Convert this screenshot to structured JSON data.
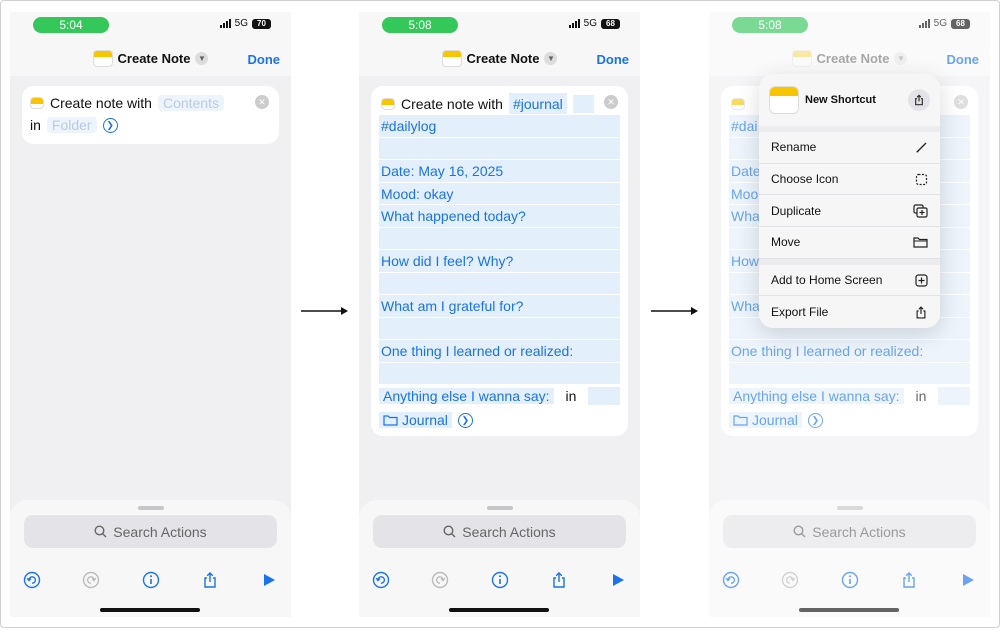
{
  "status": {
    "time_1": "5:04",
    "time_2": "5:08",
    "time_3": "5:08",
    "network": "5G",
    "battery_1": "70",
    "battery_2": "68",
    "battery_3": "68"
  },
  "nav": {
    "title": "Create Note",
    "done_label": "Done"
  },
  "action_empty": {
    "verb": "Create note with",
    "contents_placeholder": "Contents",
    "in_label": "in",
    "folder_placeholder": "Folder"
  },
  "action_filled": {
    "verb": "Create note with",
    "first_token": "#journal",
    "lines": [
      "#dailylog",
      "",
      "Date: May 16, 2025",
      "Mood: okay",
      "What happened today?",
      "",
      "How did I feel? Why?",
      "",
      "What am I grateful for?",
      "",
      "One thing I learned or realized:",
      "",
      "Anything else I wanna say:"
    ],
    "in_label": "in",
    "folder": "Journal"
  },
  "overlay_visible": {
    "line1": "#dai",
    "line3": "Date",
    "line4": "Moo",
    "line5": "Wha",
    "line7": "How",
    "line9": "Wha"
  },
  "sheet": {
    "search_placeholder": "Search Actions"
  },
  "menu": {
    "shortcut_name": "New Shortcut",
    "items_group1": [
      {
        "label": "Rename",
        "icon": "pencil-icon"
      },
      {
        "label": "Choose Icon",
        "icon": "dashed-square-icon"
      },
      {
        "label": "Duplicate",
        "icon": "duplicate-icon"
      },
      {
        "label": "Move",
        "icon": "folder-icon"
      }
    ],
    "items_group2": [
      {
        "label": "Add to Home Screen",
        "icon": "add-square-icon"
      },
      {
        "label": "Export File",
        "icon": "share-icon"
      }
    ]
  },
  "colors": {
    "accent": "#1a73e8",
    "status_pill": "#34c759",
    "token_bg": "#e3effb"
  }
}
